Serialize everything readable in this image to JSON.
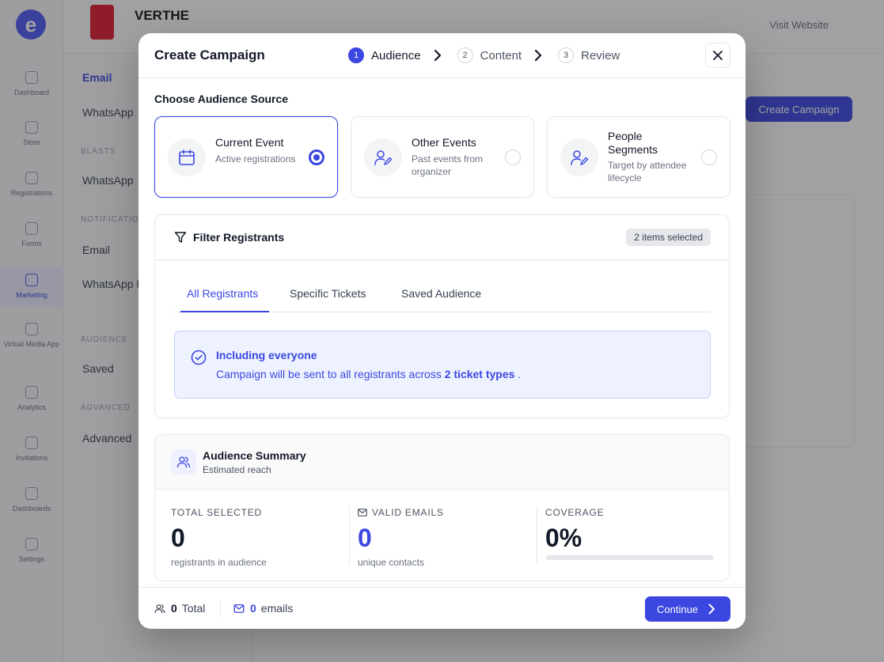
{
  "background": {
    "event_title": "VERTHE",
    "visit_website": "Visit Website",
    "create_campaign_button": "Create Campaign",
    "nav": [
      "Dashboard",
      "Store",
      "Registrations",
      "Forms",
      "Marketing",
      "Virtual Media App",
      "Analytics",
      "Invitations",
      "Dashboards",
      "Settings"
    ],
    "sub_items": [
      "Email",
      "WhatsApp",
      "WhatsApp",
      "Email",
      "WhatsApp Log",
      "Saved",
      "Advanced"
    ],
    "sub_sections": [
      "BLASTS",
      "NOTIFICATIONS",
      "AUDIENCE",
      "ADVANCED"
    ]
  },
  "modal": {
    "title": "Create Campaign",
    "steps": [
      {
        "num": "1",
        "label": "Audience"
      },
      {
        "num": "2",
        "label": "Content"
      },
      {
        "num": "3",
        "label": "Review"
      }
    ],
    "section_label": "Choose Audience Source",
    "sources": [
      {
        "title": "Current Event",
        "desc": "Active registrations",
        "selected": true,
        "icon": "calendar-icon"
      },
      {
        "title": "Other Events",
        "desc": "Past events from organizer",
        "selected": false,
        "icon": "user-edit-icon"
      },
      {
        "title": "People Segments",
        "desc": "Target by attendee lifecycle",
        "selected": false,
        "icon": "user-edit-icon"
      }
    ],
    "filter": {
      "title": "Filter Registrants",
      "badge": "2 items selected",
      "tabs": [
        "All Registrants",
        "Specific Tickets",
        "Saved Audience"
      ],
      "info_title": "Including everyone",
      "info_text_prefix": "Campaign will be sent to all registrants across",
      "info_text_bold": "2 ticket types",
      "info_text_suffix": "."
    },
    "summary": {
      "title": "Audience Summary",
      "subtitle": "Estimated reach",
      "stats": [
        {
          "label": "TOTAL SELECTED",
          "value": "0",
          "note": "registrants in audience"
        },
        {
          "label": "VALID EMAILS",
          "value": "0",
          "note": "unique contacts"
        },
        {
          "label": "COVERAGE",
          "value": "0%",
          "note": ""
        }
      ],
      "coverage_fraction": 0
    },
    "footer": {
      "total_count": "0",
      "total_label": "Total",
      "emails_count": "0",
      "emails_label": "emails",
      "continue_label": "Continue"
    }
  },
  "colors": {
    "accent": "#3b47e0",
    "info_bg": "#eef2ff",
    "border": "#e5e7eb"
  }
}
